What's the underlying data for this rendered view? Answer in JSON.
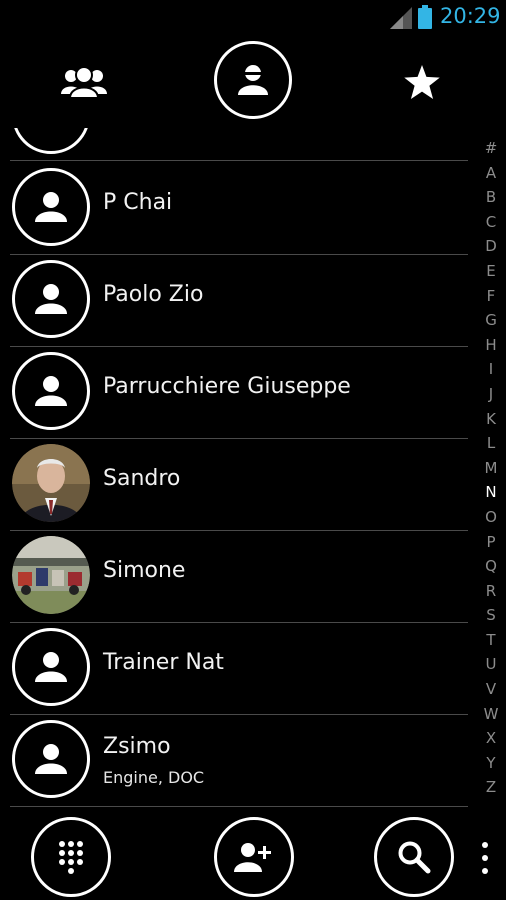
{
  "status_bar": {
    "time": "20:29",
    "time_color": "#33b5e5"
  },
  "tabs": [
    {
      "id": "groups",
      "icon": "groups-icon"
    },
    {
      "id": "contacts",
      "icon": "person-icon",
      "selected": true
    },
    {
      "id": "favorites",
      "icon": "star-icon"
    }
  ],
  "contacts": [
    {
      "name": "P Chai",
      "subtitle": "",
      "avatar": "default-avatar-icon"
    },
    {
      "name": "Paolo Zio",
      "subtitle": "",
      "avatar": "default-avatar-icon"
    },
    {
      "name": "Parrucchiere Giuseppe",
      "subtitle": "",
      "avatar": "default-avatar-icon"
    },
    {
      "name": "Sandro",
      "subtitle": "",
      "avatar": "photo"
    },
    {
      "name": "Simone",
      "subtitle": "",
      "avatar": "photo"
    },
    {
      "name": "Trainer Nat",
      "subtitle": "",
      "avatar": "default-avatar-icon"
    },
    {
      "name": "Zsimo",
      "subtitle": "Engine, DOC",
      "avatar": "default-avatar-icon"
    }
  ],
  "alpha_index": [
    "#",
    "A",
    "B",
    "C",
    "D",
    "E",
    "F",
    "G",
    "H",
    "I",
    "J",
    "K",
    "L",
    "M",
    "N",
    "O",
    "P",
    "Q",
    "R",
    "S",
    "T",
    "U",
    "V",
    "W",
    "X",
    "Y",
    "Z"
  ],
  "alpha_index_active": "N",
  "bottom_bar": [
    {
      "id": "dialpad",
      "icon": "dialpad-icon"
    },
    {
      "id": "add-contact",
      "icon": "add-contact-icon"
    },
    {
      "id": "search",
      "icon": "search-icon"
    },
    {
      "id": "overflow",
      "icon": "overflow-menu-icon"
    }
  ]
}
